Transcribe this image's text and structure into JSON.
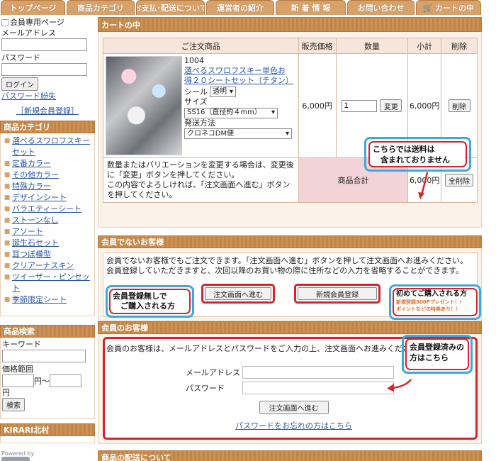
{
  "nav": {
    "tabs": [
      "トップページ",
      "商品カテゴリ",
      "お支払･配送について",
      "運営者の紹介",
      "新 着 情 報",
      "お問い合わせ",
      "カートの中"
    ],
    "cart_icon": "cart-icon"
  },
  "sidebar": {
    "member_image_alt": "会員専用ページ",
    "email_label": "メールアドレス",
    "password_label": "パスワード",
    "login_button": "ログイン",
    "forgot_link": "パスワード紛失",
    "register_link": "［新規会員登録］",
    "category_header": "商品カテゴリ",
    "categories": [
      "選べるスワロフスキーセット",
      "定番カラー",
      "その他カラー",
      "特殊カラー",
      "デザインシート",
      "バラエティーシート",
      "ストーンなし",
      "アソート",
      "誕生石セット",
      "耳つぼ模型",
      "クリアーナスキン",
      "ツイーザー・ピンセット",
      "季節限定シート"
    ],
    "search_header": "商品検索",
    "keyword_label": "キーワード",
    "price_label": "価格範囲",
    "yen_from": "円〜",
    "yen": "円",
    "search_button": "検索",
    "shop_name": "KIRARI北村",
    "powered_by": "Powered by",
    "powered_logo": "nso"
  },
  "cart": {
    "header": "カートの中",
    "columns": [
      "ご注文商品",
      "販売価格",
      "数量",
      "小計",
      "削除"
    ],
    "item": {
      "code": "1004",
      "name": "選べるスワロフスキー単色お得２０シートセット（チタン）",
      "seal_label": "シール",
      "seal_value": "透明",
      "size_label": "サイズ",
      "size_value": "SS16（直径約４mm）",
      "shipping_label": "発送方法",
      "shipping_value": "クロネコDM便",
      "price": "6,000円",
      "quantity": "1",
      "change_button": "変更",
      "subtotal": "6,000円",
      "delete_button": "削除"
    },
    "note": "数量またはバリエーションを変更する場合は、変更後に「変更」ボタンを押してください。\nこの内容でよろしければ、「注文画面へ進む」ボタンを押してください。",
    "total_label": "商品合計",
    "total_value": "6,000円",
    "delete_all_button": "全削除",
    "shipping_callout": "こちらでは送料は\n　含まれておりません"
  },
  "guest": {
    "header": "会員でないお客様",
    "text": "会員でないお客様でもご注文できます。「注文画面へ進む」ボタンを押して注文画面へお進みください。会員登録していただきますと、次回以降のお買い物の際に住所などの入力を省略することができます。",
    "order_button": "注文画面へ進む",
    "register_button": "新規会員登録",
    "callout_left": "会員登録無しで\n　ご購入される方",
    "callout_right_title": "初めてご購入される方",
    "callout_right_sub1": "新規登録300Pプレゼント！！",
    "callout_right_sub2": "ポイントなどの特典あり！！"
  },
  "member": {
    "header": "会員のお客様",
    "text": "会員のお客様は、メールアドレスとパスワードをご入力の上、注文画面へお進みください。",
    "email_label": "メールアドレス",
    "password_label": "パスワード",
    "order_button": "注文画面へ進む",
    "forgot_link": "パスワードをお忘れの方はこちら",
    "callout": "会員登録済みの\n方はこちら"
  },
  "delivery": {
    "header": "商品の配送について"
  },
  "colors": {
    "tab": "#d7a16a",
    "header_bar": "#c98a4a",
    "callout_blue": "#3fa7dd",
    "callout_red": "#d7242a",
    "link": "#2b56a6"
  }
}
